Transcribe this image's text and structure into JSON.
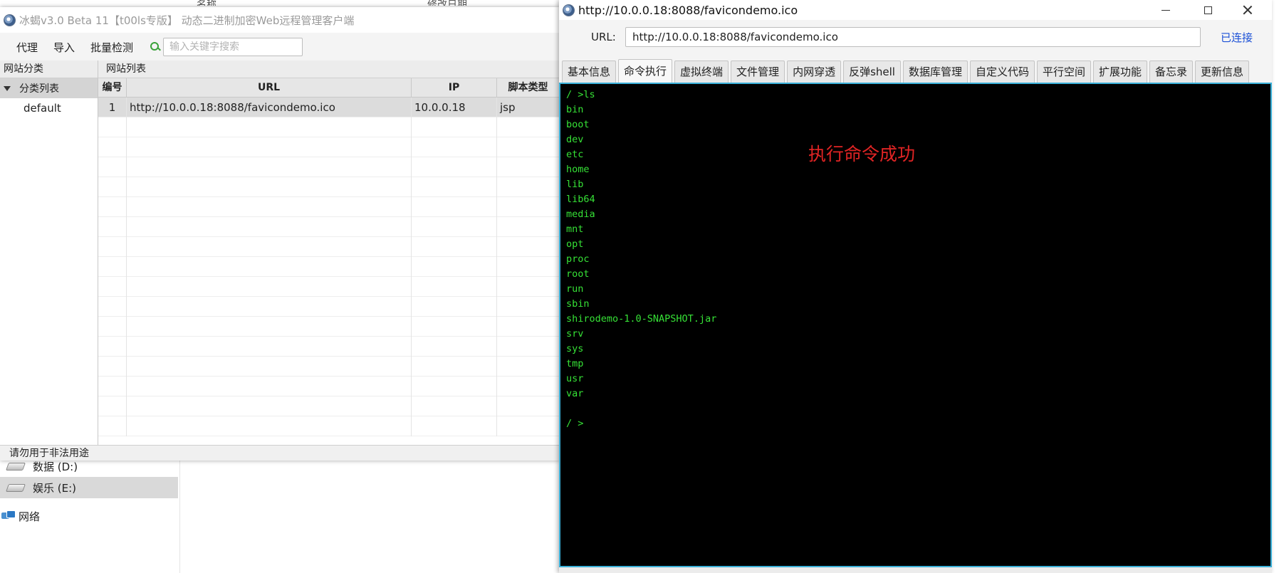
{
  "explorer": {
    "col_name": "名称",
    "col_modified": "修改日期",
    "items": [
      {
        "label": "数据 (D:)",
        "icon": "drive-icon",
        "selected": false
      },
      {
        "label": "娱乐 (E:)",
        "icon": "drive-icon",
        "selected": true
      },
      {
        "label": "网络",
        "icon": "network-icon",
        "selected": false
      }
    ]
  },
  "main_window": {
    "title": "冰蝎v3.0 Beta 11【t00ls专版】 动态二进制加密Web远程管理客户端",
    "menu": [
      "代理",
      "导入",
      "批量检测"
    ],
    "search_placeholder": "输入关键字搜索",
    "category_panel": {
      "header": "网站分类",
      "root": "分类列表",
      "child": "default"
    },
    "site_panel": {
      "header": "网站列表",
      "columns": [
        "编号",
        "URL",
        "IP",
        "脚本类型"
      ],
      "rows": [
        {
          "num": "1",
          "url": "http://10.0.0.18:8088/favicondemo.ico",
          "ip": "10.0.0.18",
          "type": "jsp"
        }
      ]
    },
    "status": "请勿用于非法用途"
  },
  "shell_window": {
    "title": "http://10.0.0.18:8088/favicondemo.ico",
    "url_label": "URL:",
    "url_value": "http://10.0.0.18:8088/favicondemo.ico",
    "connection_status": "已连接",
    "tabs": [
      "基本信息",
      "命令执行",
      "虚拟终端",
      "文件管理",
      "内网穿透",
      "反弹shell",
      "数据库管理",
      "自定义代码",
      "平行空间",
      "扩展功能",
      "备忘录",
      "更新信息"
    ],
    "active_tab": 1,
    "terminal_lines": [
      "/ >ls",
      "bin",
      "boot",
      "dev",
      "etc",
      "home",
      "lib",
      "lib64",
      "media",
      "mnt",
      "opt",
      "proc",
      "root",
      "run",
      "sbin",
      "shirodemo-1.0-SNAPSHOT.jar",
      "srv",
      "sys",
      "tmp",
      "usr",
      "var",
      "",
      "/ >"
    ],
    "annotation": "执行命令成功"
  },
  "colors": {
    "terminal_bg": "#000000",
    "terminal_text": "#36e136",
    "annotation": "#e02424",
    "connected": "#1a4fd6",
    "terminal_border": "#3ab0d8"
  }
}
